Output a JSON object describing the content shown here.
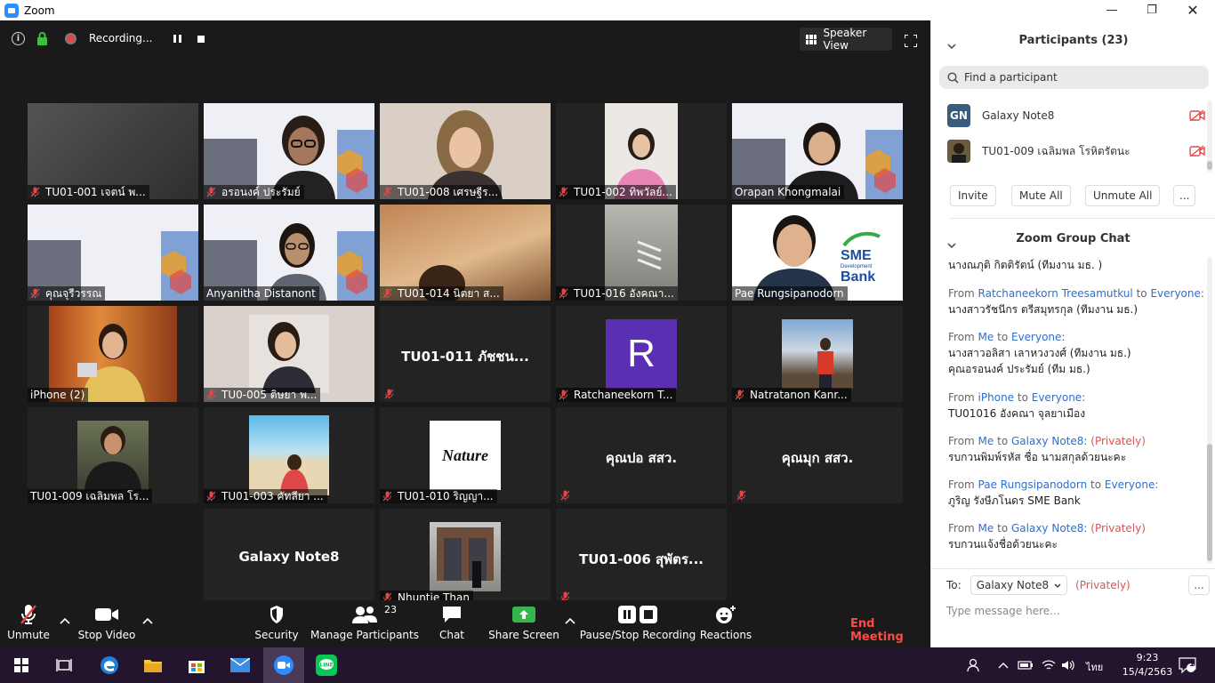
{
  "window": {
    "title": "Zoom"
  },
  "meeting_top": {
    "recording_label": "Recording...",
    "view_label": "Speaker View"
  },
  "tiles": [
    {
      "name": "TU01-001 เจตน์ พ...",
      "muted": true,
      "bg": "#3a3a3a"
    },
    {
      "name": "อรอนงค์ ประรัมย์",
      "muted": true,
      "bg": "#e8e8f0"
    },
    {
      "name": "TU01-008 เศรษฐีร...",
      "muted": true,
      "bg": "#cbbfb4"
    },
    {
      "name": "TU01-002 ทิพวัลย์...",
      "muted": true,
      "bg": "#e6e2df"
    },
    {
      "name": "Orapan Khongmalai",
      "muted": false,
      "bg": "#e8e8f0"
    },
    {
      "name": "คุณจุรีวรรณ",
      "muted": true,
      "bg": "#e8e8f0"
    },
    {
      "name": "Anyanitha Distanont",
      "muted": false,
      "bg": "#e8e8f0"
    },
    {
      "name": "TU01-014 นิตยา ส...",
      "muted": true,
      "bg": "#b27a4a"
    },
    {
      "name": "TU01-016 อังคณา...",
      "muted": true,
      "bg": "#8a8a86"
    },
    {
      "name": "Pae Rungsipanodorn",
      "muted": false,
      "bg": "#ffffff",
      "active": true
    },
    {
      "name": "iPhone (2)",
      "muted": false,
      "bg": "#b05a2a"
    },
    {
      "name": "TU0-005 ติษยา พ...",
      "muted": true,
      "bg": "#d9d2cc"
    },
    {
      "name": "TU01-011 ภัชชน...",
      "muted": true,
      "bg": "#232323",
      "center": true
    },
    {
      "name": "Ratchaneekorn T...",
      "muted": true,
      "bg": "#232323",
      "avatar_letter": "R"
    },
    {
      "name": "Natratanon Kanr...",
      "muted": true,
      "bg": "#232323"
    },
    {
      "name": "TU01-009 เฉลิมพล โร...",
      "muted": false,
      "bg": "#232323"
    },
    {
      "name": "TU01-003 คัทลียา ...",
      "muted": true,
      "bg": "#232323"
    },
    {
      "name": "TU01-010 ริญญา...",
      "muted": true,
      "bg": "#232323",
      "logo_text": "Nature"
    },
    {
      "name": "คุณปอ สสว.",
      "muted": true,
      "bg": "#232323",
      "center": true
    },
    {
      "name": "คุณมุก สสว.",
      "muted": true,
      "bg": "#232323",
      "center": true
    },
    {
      "name": "Galaxy Note8",
      "muted": false,
      "bg": "#232323",
      "center": true,
      "no_mic": true
    },
    {
      "name": "Nhuntie Than",
      "muted": true,
      "bg": "#232323"
    },
    {
      "name": "TU01-006 สุพัตร...",
      "muted": true,
      "bg": "#232323",
      "center": true
    }
  ],
  "sme_logo": {
    "line1": "SME",
    "line2": "Development",
    "line3": "Bank"
  },
  "toolbar": {
    "unmute": "Unmute",
    "stop_video": "Stop Video",
    "security": "Security",
    "manage_participants": "Manage Participants",
    "participant_count": "23",
    "chat": "Chat",
    "share_screen": "Share Screen",
    "pause_stop_recording": "Pause/Stop Recording",
    "reactions": "Reactions",
    "end_meeting": "End Meeting"
  },
  "participants_panel": {
    "title": "Participants (23)",
    "search_placeholder": "Find a participant",
    "list": [
      {
        "name": "Galaxy Note8",
        "avatar": "GN"
      },
      {
        "name": "TU01-009 เฉลิมพล โรหิตรัตนะ",
        "avatar": ""
      }
    ],
    "buttons": {
      "invite": "Invite",
      "mute_all": "Mute All",
      "unmute_all": "Unmute All",
      "more": "..."
    }
  },
  "chat_panel": {
    "title": "Zoom Group Chat",
    "messages": [
      {
        "from": "",
        "to": "",
        "privately": "",
        "lines": [
          "นางณภุติ กิตติรัตน์ (ทีมงาน มธ. )"
        ]
      },
      {
        "from_label": "From ",
        "from": "Ratchaneekorn Treesamutkul",
        "to_label": " to ",
        "to": "Everyone",
        "suffix": ":",
        "privately": "",
        "lines": [
          "นางสาวรัชนีกร ตรีสมุทรกุล (ทีมงาน มธ.)"
        ]
      },
      {
        "from_label": "From ",
        "from": "Me",
        "to_label": " to ",
        "to": "Everyone",
        "suffix": ":",
        "privately": "",
        "lines": [
          "นางสาวอลิสา เลาหวงวงศ์ (ทีมงาน มธ.)",
          "คุณอรอนงค์ ประรัมย์ (ทีม มธ.)"
        ]
      },
      {
        "from_label": "From ",
        "from": "iPhone",
        "to_label": " to ",
        "to": "Everyone",
        "suffix": ":",
        "privately": "",
        "lines": [
          "TU01016 อังคณา จุลยาเมือง"
        ]
      },
      {
        "from_label": "From ",
        "from": "Me",
        "to_label": " to ",
        "to": "Galaxy Note8",
        "suffix": ":",
        "privately": "(Privately)",
        "lines": [
          "รบกวนพิมพ์รหัส ชื่อ นามสกุลด้วยนะคะ"
        ]
      },
      {
        "from_label": "From ",
        "from": "Pae Rungsipanodorn",
        "to_label": " to ",
        "to": "Everyone",
        "suffix": ":",
        "privately": "",
        "lines": [
          "ภูริญ รังษีภโนดร SME Bank"
        ]
      },
      {
        "from_label": "From ",
        "from": "Me",
        "to_label": " to ",
        "to": "Galaxy Note8",
        "suffix": ":",
        "privately": "(Privately)",
        "lines": [
          "รบกวนแจ้งชื่อด้วยนะคะ"
        ]
      }
    ],
    "to_label": "To:",
    "to_value": "Galaxy Note8",
    "to_privately": "(Privately)",
    "more": "...",
    "input_placeholder": "Type message here..."
  },
  "taskbar": {
    "lang": "ไทย",
    "time": "9:23",
    "date": "15/4/2563",
    "notif_count": "1"
  }
}
